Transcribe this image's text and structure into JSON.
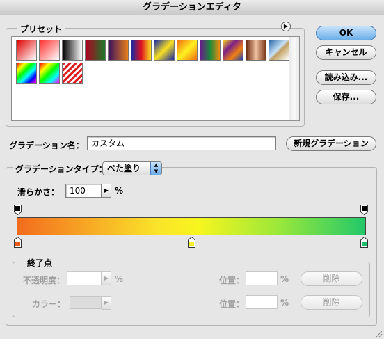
{
  "window": {
    "title": "グラデーションエディタ"
  },
  "presets": {
    "label": "プリセット",
    "swatches": [
      {
        "name": "red-white",
        "css": "linear-gradient(135deg, #e00000, #ffffff)"
      },
      {
        "name": "red-transparent",
        "css": "linear-gradient(135deg, #ff3030 0%, #ffaaaa 60%, #ffffff 100%)"
      },
      {
        "name": "black-white",
        "css": "linear-gradient(90deg, #000000, #ffffff)"
      },
      {
        "name": "red-green",
        "css": "linear-gradient(90deg, #b00020, #1a7a2a)"
      },
      {
        "name": "violet-orange",
        "css": "linear-gradient(90deg, #3a1060, #e8801a)"
      },
      {
        "name": "blue-red-yellow",
        "css": "linear-gradient(90deg, #1a2aa0, #e01020, #f8e020)"
      },
      {
        "name": "blue-yellow-blue",
        "css": "linear-gradient(135deg, #1a2aa0 0%, #f8e020 50%, #1a2aa0 100%)"
      },
      {
        "name": "orange-yellow-orange",
        "css": "linear-gradient(135deg, #f07010 0%, #fff020 50%, #f07010 100%)"
      },
      {
        "name": "violet-green-orange",
        "css": "linear-gradient(90deg, #6a1a8a, #1a8a3a, #f08a10)"
      },
      {
        "name": "yellow-violet-orange-blue",
        "css": "linear-gradient(135deg, #f8d020, #7a208a, #f08010, #2040b0)"
      },
      {
        "name": "copper",
        "css": "linear-gradient(90deg, #6a2a10, #f0c0a0, #7a3a18)"
      },
      {
        "name": "chrome",
        "css": "linear-gradient(135deg, #2a6aa8 0%, #c8e0f8 45%, #c0a060 55%, #ffffff 100%)"
      },
      {
        "name": "spectrum",
        "css": "linear-gradient(135deg, #ff0000, #ffff00, #00ff00, #00ffff, #0000ff, #ff00ff)"
      },
      {
        "name": "transparent-rainbow",
        "css": "linear-gradient(135deg, #ff0000 0%, #ffff00 25%, #00ff00 50%, #00ffff 75%, #ff00ff 100%)"
      },
      {
        "name": "transparent-stripes",
        "css": "repeating-linear-gradient(135deg, #e02020 0 3px, #ffffff 3px 6px)"
      }
    ]
  },
  "buttons": {
    "ok": "OK",
    "cancel": "キャンセル",
    "load": "読み込み...",
    "save": "保存...",
    "new_gradient": "新規グラデーション",
    "delete_opacity": "削除",
    "delete_color": "削除"
  },
  "name_field": {
    "label": "グラデーション名：",
    "value": "カスタム"
  },
  "gradient_type": {
    "label": "グラデーションタイプ：",
    "selected": "べた塗り",
    "smoothness_label": "滑らかさ：",
    "smoothness_value": "100",
    "smoothness_unit": "%"
  },
  "gradient": {
    "css": "linear-gradient(90deg, #f26c1e 0%, #fbe32a 40%, #f7f51e 52%, #9be83a 75%, #22c86a 100%)",
    "color_stops": [
      {
        "name": "stop-orange",
        "color": "#e8591a"
      },
      {
        "name": "stop-yellow",
        "color": "#f5f028"
      },
      {
        "name": "stop-green",
        "color": "#1ebd6a"
      }
    ]
  },
  "stops_group": {
    "label": "終了点",
    "opacity_label": "不透明度：",
    "opacity_unit": "%",
    "location_label_1": "位置：",
    "location_unit_1": "%",
    "color_label": "カラー：",
    "location_label_2": "位置：",
    "location_unit_2": "%"
  }
}
